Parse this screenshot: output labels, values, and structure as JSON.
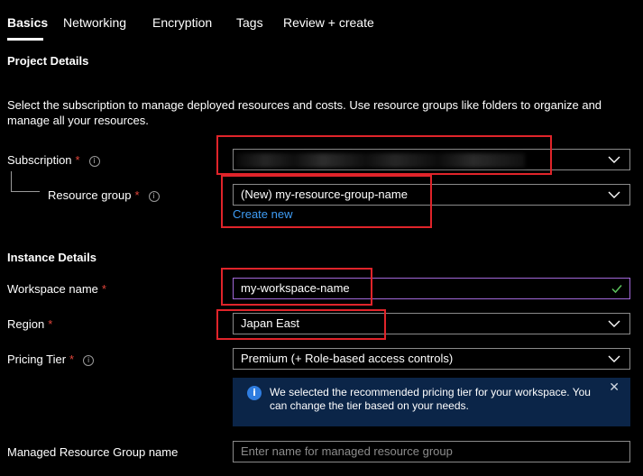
{
  "tabs": [
    {
      "label": "Basics",
      "active": true
    },
    {
      "label": "Networking"
    },
    {
      "label": "Encryption"
    },
    {
      "label": "Tags"
    },
    {
      "label": "Review + create"
    }
  ],
  "project": {
    "title": "Project Details",
    "description": "Select the subscription to manage deployed resources and costs. Use resource groups like folders to organize and manage all your resources.",
    "subscription_label": "Subscription",
    "subscription_value": "",
    "resource_group_label": "Resource group",
    "resource_group_value": "(New) my-resource-group-name",
    "create_new_link": "Create new"
  },
  "instance": {
    "title": "Instance Details",
    "workspace_label": "Workspace name",
    "workspace_value": "my-workspace-name",
    "region_label": "Region",
    "region_value": "Japan East",
    "pricing_label": "Pricing Tier",
    "pricing_value": "Premium (+ Role-based access controls)",
    "info_message": "We selected the recommended pricing tier for your workspace. You can change the tier based on your needs.",
    "managed_rg_label": "Managed Resource Group name",
    "managed_rg_placeholder": "Enter name for managed resource group"
  },
  "required_mark": "*",
  "colors": {
    "required": "#e0443a",
    "link": "#3f9df5",
    "highlight": "#e0242a",
    "info_bg": "#0b2548"
  }
}
